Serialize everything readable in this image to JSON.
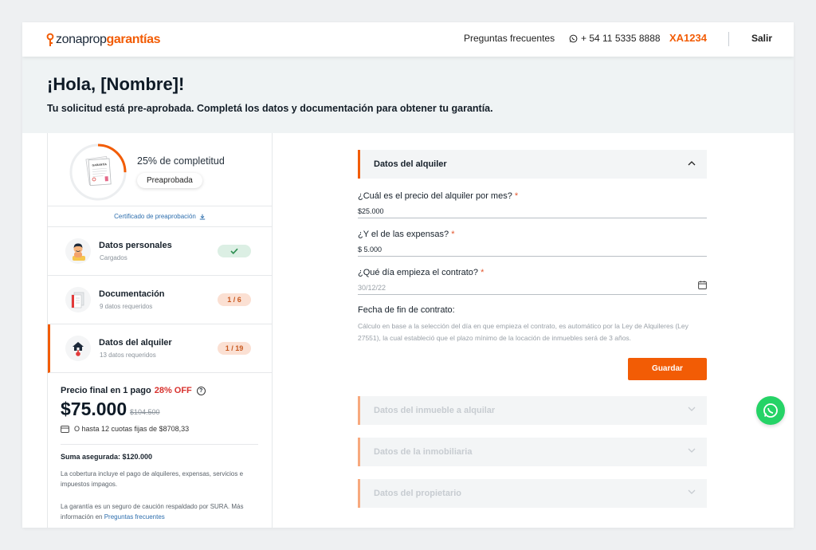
{
  "header": {
    "logo_a": "zonaprop",
    "logo_b": "garantías",
    "faq": "Preguntas frecuentes",
    "phone": "+ 54 11 5335 8888",
    "code": "XA1234",
    "exit": "Salir"
  },
  "hero": {
    "title": "¡Hola, [Nombre]!",
    "subtitle": "Tu solicitud está pre-aprobada. Completá los datos y documentación para obtener tu garantía."
  },
  "progress": {
    "percent": 25,
    "label": "25% de completitud",
    "status": "Preaprobada",
    "doc_label": "GARANTÍA",
    "certificate": "Certificado de preaprobación"
  },
  "steps": [
    {
      "title": "Datos personales",
      "subtitle": "Cargados",
      "badge": "✓",
      "state": "ok"
    },
    {
      "title": "Documentación",
      "subtitle": "9 datos requeridos",
      "badge": "1 / 6",
      "state": "count"
    },
    {
      "title": "Datos del alquiler",
      "subtitle": "13 datos requeridos",
      "badge": "1 / 19",
      "state": "count"
    }
  ],
  "pricing": {
    "label": "Precio final en 1 pago",
    "discount": "28% OFF",
    "help_icon": "?",
    "price": "$75.000",
    "old_price": "$104.500",
    "installments": "O hasta 12 cuotas fijas de $8708,33",
    "insured": "Suma asegurada: $120.000",
    "coverage": "La cobertura incluye el pago de alquileres, expensas, servicios e impuestos impagos.",
    "guarantee": "La garantía es un seguro de caución respaldado por SURA. Más información en",
    "guarantee_link": "Preguntas frecuentes"
  },
  "form": {
    "section_title": "Datos del alquiler",
    "rent_label": "¿Cuál es el precio del alquiler por mes?",
    "rent_value": "$25.000",
    "expenses_label": "¿Y el de las expensas?",
    "expenses_value": "$ 5.000",
    "start_label": "¿Qué día empieza el contrato?",
    "start_placeholder": "30/12/22",
    "required_mark": "*",
    "end_label": "Fecha de fin de contrato:",
    "end_desc": "Cálculo en base a la selección del día en que empieza el contrato, es automático por la Ley de Alquileres (Ley 27551), la cual estableció que el plazo mínimo de la locación de inmuebles será de 3 años.",
    "save": "Guardar"
  },
  "sections": [
    {
      "title": "Datos del inmueble a alquilar"
    },
    {
      "title": "Datos de la inmobiliaria"
    },
    {
      "title": "Datos del propietario"
    }
  ],
  "colors": {
    "accent": "#f25c05",
    "success": "#2d8e51",
    "whatsapp": "#25d366"
  }
}
